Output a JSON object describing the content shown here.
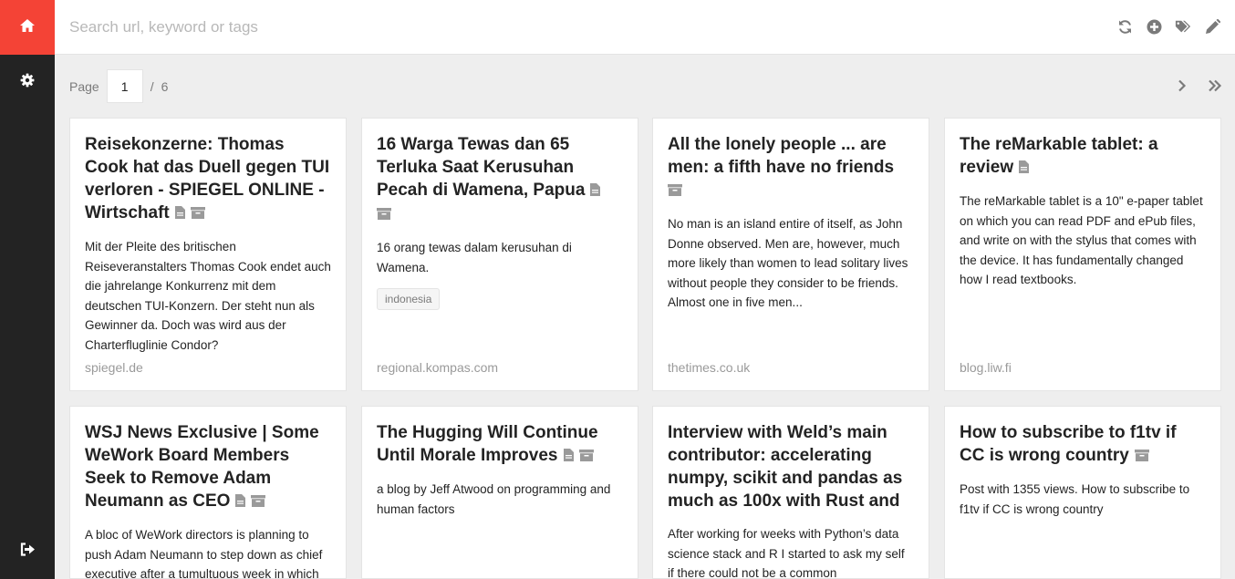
{
  "search": {
    "placeholder": "Search url, keyword or tags"
  },
  "sidebar": {
    "icons": [
      "home-icon",
      "gear-icon",
      "logout-icon"
    ]
  },
  "toolbar": {
    "icons": [
      "refresh-icon",
      "add-icon",
      "tags-icon",
      "edit-icon"
    ]
  },
  "pagination": {
    "label": "Page",
    "current": "1",
    "separator": "/",
    "total": "6"
  },
  "colors": {
    "accent": "#f44336",
    "sidebar": "#232323",
    "background": "#eeeeee",
    "card": "#ffffff"
  },
  "bookmarks": [
    {
      "title": "Reisekonzerne: Thomas Cook hat das Duell gegen TUI verloren - SPIEGEL ONLINE - Wirtschaft",
      "excerpt": "Mit der Pleite des britischen Reiseveranstalters Thomas Cook endet auch die jahrelange Konkurrenz mit dem deutschen TUI-Konzern. Der steht nun als Gewinner da. Doch was wird aus der Charterfluglinie Condor?",
      "tags": [],
      "url": "spiegel.de"
    },
    {
      "title": "16 Warga Tewas dan 65 Terluka Saat Kerusuhan Pecah di Wamena, Papua",
      "excerpt": "16 orang tewas dalam kerusuhan di Wamena.",
      "tags": [
        "indonesia"
      ],
      "url": "regional.kompas.com"
    },
    {
      "title": "All the lonely people ... are men: a fifth have no friends",
      "excerpt": "No man is an island entire of itself, as John Donne observed. Men are, however, much more likely than women to lead solitary lives without people they consider to be friends. Almost one in five men...",
      "tags": [],
      "url": "thetimes.co.uk"
    },
    {
      "title": "The reMarkable tablet: a review",
      "excerpt": "The reMarkable tablet is a 10\" e-paper tablet on which you can read PDF and ePub files, and write on with the stylus that comes with the device. It has fundamentally changed how I read textbooks.",
      "tags": [],
      "url": "blog.liw.fi"
    },
    {
      "title": "WSJ News Exclusive | Some WeWork Board Members Seek to Remove Adam Neumann as CEO",
      "excerpt": "A bloc of WeWork directors is planning to push Adam Neumann to step down as chief executive after a tumultuous week in which",
      "tags": [],
      "url": ""
    },
    {
      "title": "The Hugging Will Continue Until Morale Improves",
      "excerpt": "a blog by Jeff Atwood on programming and human factors",
      "tags": [],
      "url": ""
    },
    {
      "title": "Interview with Weld’s main contributor: accelerating numpy, scikit and pandas as much as 100x with Rust and",
      "excerpt": "After working for weeks with Python’s data science stack and R I started to ask my self if there could not be a common",
      "tags": [],
      "url": ""
    },
    {
      "title": "How to subscribe to f1tv if CC is wrong country",
      "excerpt": "Post with 1355 views. How to subscribe to f1tv if CC is wrong country",
      "tags": [],
      "url": ""
    }
  ]
}
